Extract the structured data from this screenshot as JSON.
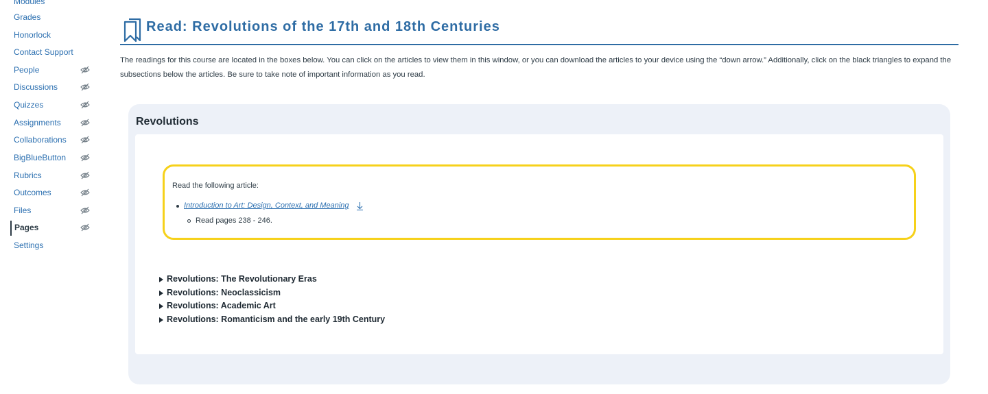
{
  "nav": {
    "items": [
      {
        "label": "Modules",
        "hidden": false,
        "active": false
      },
      {
        "label": "Grades",
        "hidden": false,
        "active": false
      },
      {
        "label": "Honorlock",
        "hidden": false,
        "active": false
      },
      {
        "label": "Contact Support",
        "hidden": false,
        "active": false
      },
      {
        "label": "People",
        "hidden": true,
        "active": false
      },
      {
        "label": "Discussions",
        "hidden": true,
        "active": false
      },
      {
        "label": "Quizzes",
        "hidden": true,
        "active": false
      },
      {
        "label": "Assignments",
        "hidden": true,
        "active": false
      },
      {
        "label": "Collaborations",
        "hidden": true,
        "active": false
      },
      {
        "label": "BigBlueButton",
        "hidden": true,
        "active": false
      },
      {
        "label": "Rubrics",
        "hidden": true,
        "active": false
      },
      {
        "label": "Outcomes",
        "hidden": true,
        "active": false
      },
      {
        "label": "Files",
        "hidden": true,
        "active": false
      },
      {
        "label": "Pages",
        "hidden": true,
        "active": true
      },
      {
        "label": "Settings",
        "hidden": false,
        "active": false
      }
    ]
  },
  "header": {
    "title": "Read: Revolutions of the 17th and 18th Centuries",
    "icon": "bookmark-icon"
  },
  "intro": "The readings for this course are located in the boxes below. You can click on the articles to view them in this window, or you can download the articles to your device using the “down arrow.” Additionally, click on the black triangles to expand the subsections below the articles. Be sure to take note of important information as you read.",
  "panel": {
    "title": "Revolutions",
    "reading": {
      "intro": "Read the following article:",
      "article_link": "Introduction to Art: Design, Context, and Meaning",
      "pages": "Read pages 238 - 246."
    },
    "sections": [
      "Revolutions: The Revolutionary Eras",
      "Revolutions: Neoclassicism",
      "Revolutions: Academic Art",
      "Revolutions: Romanticism and the early 19th Century"
    ]
  },
  "colors": {
    "link": "#2b6fb0",
    "title": "#2e6ca4",
    "highlight_border": "#f6d11a",
    "panel_bg": "#edf1f8"
  }
}
